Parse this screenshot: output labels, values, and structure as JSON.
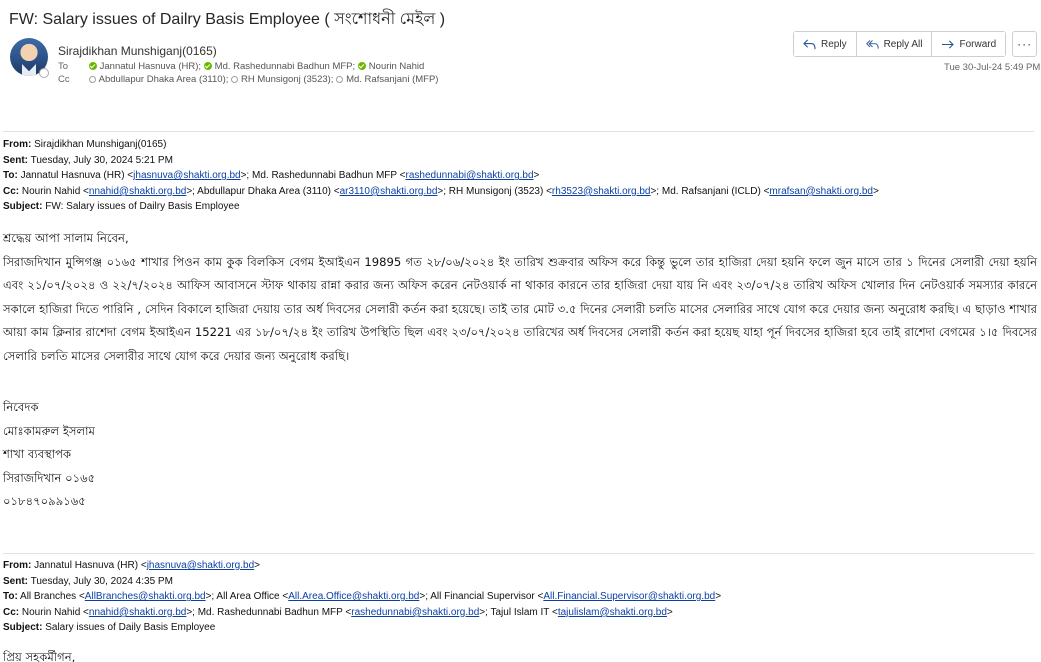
{
  "subject": "FW: Salary issues of Dailry Basis Employee   ( সংশোধনী মেইল )",
  "sender": {
    "name": "Sirajdikhan Munshiganj(0165)"
  },
  "to_line": {
    "label": "To",
    "recipients": [
      {
        "name": "Jannatul Hasnuva (HR);",
        "status": "online"
      },
      {
        "name": "Md. Rashedunnabi Badhun MFP;",
        "status": "online"
      },
      {
        "name": "Nourin Nahid",
        "status": "online"
      }
    ]
  },
  "cc_line": {
    "label": "Cc",
    "recipients": [
      {
        "name": "Abdullapur Dhaka Area (3110);",
        "status": "offline"
      },
      {
        "name": "RH Munsigonj (3523);",
        "status": "offline"
      },
      {
        "name": "Md. Rafsanjani (MFP)",
        "status": "offline"
      }
    ]
  },
  "toolbar": {
    "reply": "Reply",
    "reply_all": "Reply All",
    "forward": "Forward",
    "more": "···",
    "icons": [
      "reply-icon",
      "reply-all-icon",
      "forward-icon",
      "more-icon"
    ]
  },
  "received_date": "Tue 30-Jul-24 5:49 PM",
  "forwarded_header_1": {
    "from_label": "From:",
    "from": " Sirajdikhan Munshiganj(0165)",
    "sent_label": "Sent:",
    "sent": " Tuesday, July 30, 2024 5:21 PM",
    "to_label": "To:",
    "to_1": " Jannatul Hasnuva (HR) <",
    "to_1_email": "jhasnuva@shakti.org.bd",
    "to_2": ">; Md. Rashedunnabi Badhun MFP <",
    "to_2_email": "rashedunnabi@shakti.org.bd",
    "to_end": ">",
    "cc_label": "Cc:",
    "cc_1": " Nourin Nahid <",
    "cc_1_email": "nnahid@shakti.org.bd",
    "cc_2": ">; Abdullapur Dhaka Area (3110) <",
    "cc_2_email": "ar3110@shakti.org.bd",
    "cc_3": ">; RH Munsigonj (3523) <",
    "cc_3_email": "rh3523@shakti.org.bd",
    "cc_4": ">; Md. Rafsanjani (ICLD) <",
    "cc_4_email": "mrafsan@shakti.org.bd",
    "cc_end": ">",
    "subject_label": "Subject:",
    "subject": " FW: Salary issues of Dailry Basis Employee"
  },
  "body": {
    "greeting": "শ্রদ্ধেয় আপা সালাম নিবেন,",
    "paragraph": "সিরাজদিখান মুন্সিগঞ্জ ০১৬৫ শাখার পিওন কাম কুক বিলকিস বেগম ইআইএন 19895  গত ২৮/০৬/২০২৪ ইং তারিখ শুক্রবার অফিস করে কিন্তু ভুলে তার হাজিরা দেয়া হয়নি ফলে জুন মাসে তার ১ দিনের সেলারী দেয়া হয়নি এবং ২১/০৭/২০২৪ ও ২২/৭/২০২৪ আফিস আবাসনে স্টাফ থাকায় রান্না করার জন্য অফিস করেন  নেটওয়ার্ক না থাকার কারনে তার হাজিরা দেয়া যায় নি এবং ২৩/০৭/২৪ তারিখ অফিস খোলার দিন নেটওয়ার্ক সমস্যার কারনে সকালে হাজিরা দিতে পারিনি , সেদিন বিকালে হাজিরা দেয়ায় তার অর্ধ দিবসের সেলারী কর্তন করা হয়েছে। তাই তার মোট ৩.৫ দিনের সেলারী চলতি মাসের সেলারির সাথে যোগ করে দেয়ার জন্য অনুরোধ করছি। এ ছাড়াও শাখার আয়া কাম ক্লিনার রাশেদা বেগম ইআইএন 15221 এর ১৮/০৭/২৪ ইং তারিখ উপস্থিতি ছিল এবং ২৩/০৭/২০২৪ তারিখের অর্ধ দিবসের সেলারী কর্তন করা হয়েছ যাহা পূর্ন দিবসের হাজিরা হবে তাই রাশেদা বেগমের ১।৫   দিবসের সেলারি চলতি মাসের সেলারীর সাথে যোগ করে দেয়ার জন্য অনুরোধ করছি।",
    "signature": [
      "নিবেদক",
      "মোঃকামরুল ইসলাম",
      "শাখা ব্যবস্থাপক",
      "সিরাজদিখান ০১৬৫",
      "০১৮৪৭০৯৯১৬৫"
    ]
  },
  "forwarded_header_2": {
    "from_label": "From:",
    "from": " Jannatul Hasnuva (HR) <",
    "from_email": "jhasnuva@shakti.org.bd",
    "from_end": ">",
    "sent_label": "Sent:",
    "sent": " Tuesday, July 30, 2024 4:35 PM",
    "to_label": "To:",
    "to_1": " All Branches <",
    "to_1_email": "AllBranches@shakti.org.bd",
    "to_2": ">; All Area Office <",
    "to_2_email": "All.Area.Office@shakti.org.bd",
    "to_3": ">; All Financial Supervisor <",
    "to_3_email": "All.Financial.Supervisor@shakti.org.bd",
    "to_end": ">",
    "cc_label": "Cc:",
    "cc_1": " Nourin Nahid <",
    "cc_1_email": "nnahid@shakti.org.bd",
    "cc_2": ">; Md. Rashedunnabi Badhun MFP <",
    "cc_2_email": "rashedunnabi@shakti.org.bd",
    "cc_3": ">; Tajul Islam IT <",
    "cc_3_email": "tajulislam@shakti.org.bd",
    "cc_end": ">",
    "subject_label": "Subject:",
    "subject": " Salary issues of Daily Basis Employee"
  },
  "body_2": {
    "greeting": "প্রিয় সহকর্মীগন,"
  },
  "colors": {
    "link": "#0b3fa5",
    "online": "#6bb700",
    "accent": "#2b579a"
  }
}
